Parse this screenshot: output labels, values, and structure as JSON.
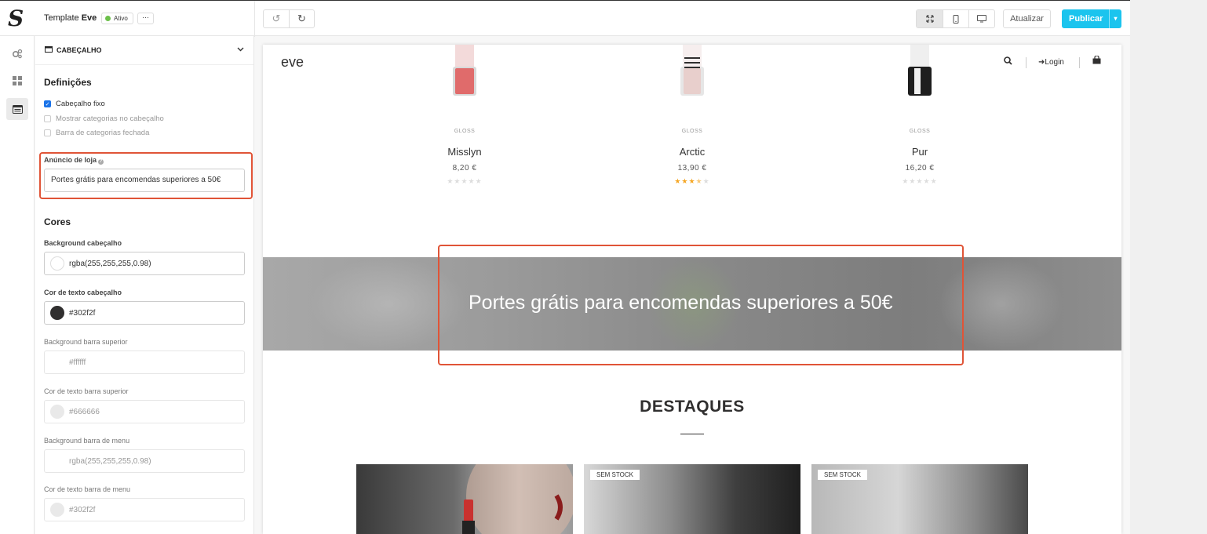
{
  "app": {
    "template_label": "Template",
    "template_name": "Eve",
    "status": "Ativo",
    "more": "···"
  },
  "toolbar": {
    "update_label": "Atualizar",
    "publish_label": "Publicar"
  },
  "panel": {
    "section": "CABEÇALHO",
    "definitions_title": "Definições",
    "checkboxes": [
      {
        "label": "Cabeçalho fixo",
        "checked": true
      },
      {
        "label": "Mostrar categorias no cabeçalho",
        "checked": false
      },
      {
        "label": "Barra de categorias fechada",
        "checked": false
      }
    ],
    "store_announcement_label": "Anúncio de loja",
    "store_announcement_value": "Portes grátis para encomendas superiores a 50€",
    "colors_title": "Cores",
    "colors": [
      {
        "label": "Background cabeçalho",
        "value": "rgba(255,255,255,0.98)",
        "swatch": "#ffffff"
      },
      {
        "label": "Cor de texto cabeçalho",
        "value": "#302f2f",
        "swatch": "#302f2f"
      },
      {
        "label": "Background barra superior",
        "value": "#ffffff",
        "swatch": "#ffffff"
      },
      {
        "label": "Cor de texto barra superior",
        "value": "#666666",
        "swatch": "#e9e9e9"
      },
      {
        "label": "Background barra de menu",
        "value": "rgba(255,255,255,0.98)",
        "swatch": "#ffffff"
      },
      {
        "label": "Cor de texto barra de menu",
        "value": "#302f2f",
        "swatch": "#e9e9e9"
      }
    ]
  },
  "preview": {
    "logo": "eve",
    "login": "Login",
    "products": [
      {
        "category": "GLOSS",
        "name": "Misslyn",
        "price": "8,20 €",
        "rating": 0,
        "color": "#e06b6b"
      },
      {
        "category": "GLOSS",
        "name": "Arctic",
        "price": "13,90 €",
        "rating": 3.5,
        "color": "#e8cfcc"
      },
      {
        "category": "GLOSS",
        "name": "Pur",
        "price": "16,20 €",
        "rating": 0,
        "color": "#2a2a2a"
      }
    ],
    "banner_text": "Portes grátis para encomendas superiores a 50€",
    "featured_title": "DESTAQUES",
    "cards": [
      {
        "badge": ""
      },
      {
        "badge": "SEM STOCK"
      },
      {
        "badge": "SEM STOCK"
      }
    ]
  },
  "colors": {
    "accent": "#1bc4ee",
    "highlight": "#e05437",
    "text": "#302f2f",
    "star": "#f5a623"
  }
}
